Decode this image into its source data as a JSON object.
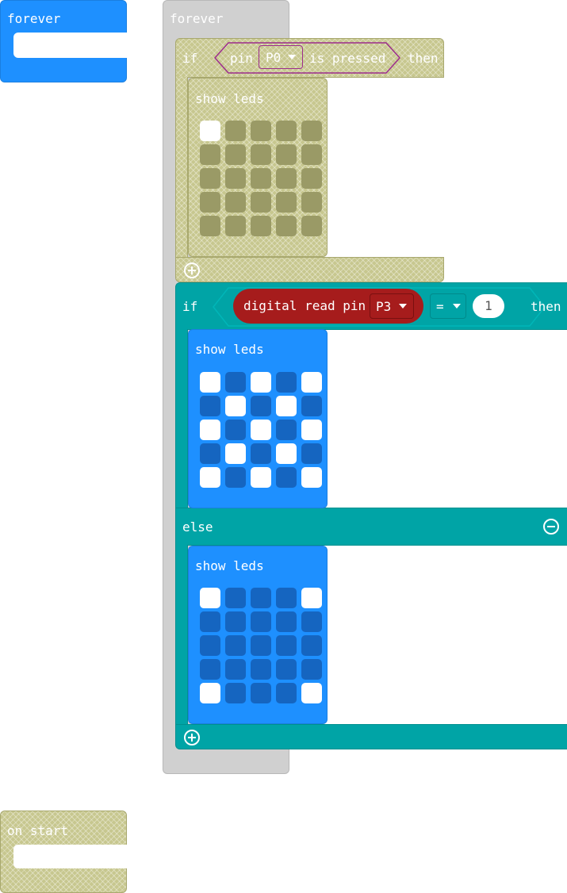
{
  "workspace": {
    "forever_small": {
      "label": "forever"
    },
    "forever_main": {
      "label": "forever"
    },
    "on_start": {
      "label": "on start"
    },
    "if1": {
      "if_label": "if",
      "pin_label": "pin",
      "pin_value": "P0",
      "is_pressed_label": "is pressed",
      "then_label": "then",
      "show_leds_label": "show leds",
      "leds": [
        [
          1,
          0,
          0,
          0,
          0
        ],
        [
          0,
          0,
          0,
          0,
          0
        ],
        [
          0,
          0,
          0,
          0,
          0
        ],
        [
          0,
          0,
          0,
          0,
          0
        ],
        [
          0,
          0,
          0,
          0,
          0
        ]
      ]
    },
    "if2": {
      "if_label": "if",
      "digital_read_label": "digital read pin",
      "pin_value": "P3",
      "operator": "=",
      "compare_value": "1",
      "then_label": "then",
      "else_label": "else",
      "show_leds_label_then": "show leds",
      "leds_then": [
        [
          1,
          0,
          1,
          0,
          1
        ],
        [
          0,
          1,
          0,
          1,
          0
        ],
        [
          1,
          0,
          1,
          0,
          1
        ],
        [
          0,
          1,
          0,
          1,
          0
        ],
        [
          1,
          0,
          1,
          0,
          1
        ]
      ],
      "show_leds_label_else": "show leds",
      "leds_else": [
        [
          1,
          0,
          0,
          0,
          1
        ],
        [
          0,
          0,
          0,
          0,
          0
        ],
        [
          0,
          0,
          0,
          0,
          0
        ],
        [
          0,
          0,
          0,
          0,
          0
        ],
        [
          1,
          0,
          0,
          0,
          1
        ]
      ]
    }
  },
  "colors": {
    "led_on": "#ffffff",
    "led_off_disabled": "#9a9a66",
    "led_off_enabled": "#1565c0",
    "loops_blue": "#1e90ff",
    "logic_teal": "#00a4a6",
    "pins_red": "#a61c1c",
    "disabled": "#c7c78f"
  }
}
